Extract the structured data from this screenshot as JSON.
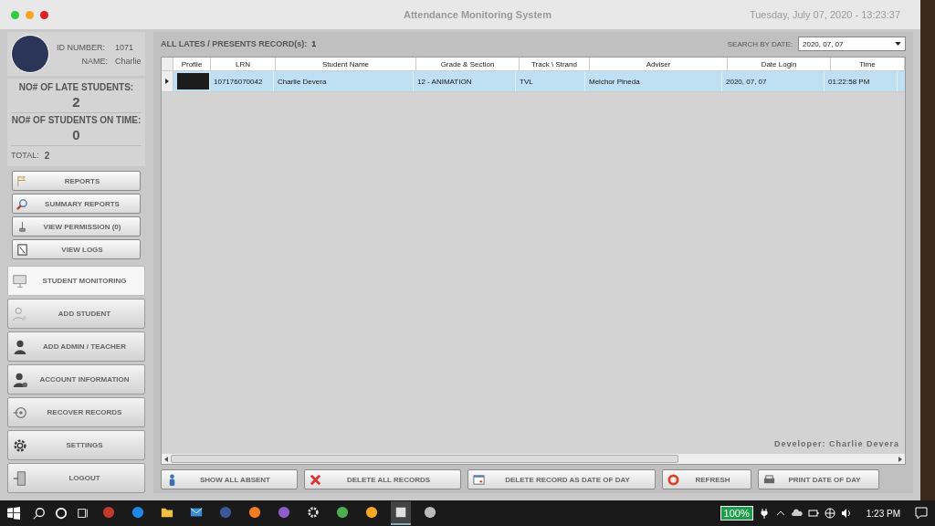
{
  "window": {
    "title": "Attendance Monitoring System",
    "datetime": "Tuesday, July  07, 2020 - 13:23:37"
  },
  "user": {
    "id_label": "ID NUMBER:",
    "id": "1071",
    "name_label": "NAME:",
    "name": "Charlie"
  },
  "stats": {
    "late_label": "NO# OF LATE STUDENTS:",
    "late": "2",
    "ontime_label": "NO# OF STUDENTS ON TIME:",
    "ontime": "0",
    "total_label": "TOTAL:",
    "total": "2"
  },
  "report_buttons": [
    {
      "label": "REPORTS",
      "kind": "flag"
    },
    {
      "label": "SUMMARY REPORTS",
      "kind": "search"
    },
    {
      "label": "VIEW PERMISSION (0)",
      "kind": "pin"
    },
    {
      "label": "VIEW LOGS",
      "kind": "log"
    }
  ],
  "nav": [
    {
      "label": "STUDENT MONITORING",
      "kind": "monitor",
      "selected": true
    },
    {
      "label": "ADD STUDENT",
      "kind": "user-outline",
      "selected": false
    },
    {
      "label": "ADD ADMIN / TEACHER",
      "kind": "user",
      "selected": false
    },
    {
      "label": "ACCOUNT INFORMATION",
      "kind": "user-info",
      "selected": false
    },
    {
      "label": "RECOVER RECORDS",
      "kind": "recover",
      "selected": false
    },
    {
      "label": "SETTINGS",
      "kind": "gear",
      "selected": false
    },
    {
      "label": "LOGOUT",
      "kind": "door",
      "selected": false
    }
  ],
  "records": {
    "title": "ALL LATES / PRESENTS RECORD(s):",
    "count": "1",
    "search_label": "SEARCH BY DATE:",
    "search_value": "2020, 07, 07"
  },
  "table": {
    "columns": [
      "Profile",
      "LRN",
      "Student Name",
      "Grade & Section",
      "Track \\ Strand",
      "Adviser",
      "Date Login",
      "Time"
    ],
    "rows": [
      {
        "selected": true,
        "cells": [
          "",
          "107176070042",
          "Charlie Devera",
          "12 - ANIMATION",
          "TVL",
          "Melchor Pineda",
          "2020, 07, 07",
          "01:22:58 PM"
        ]
      }
    ]
  },
  "developer": "Developer: Charlie Devera",
  "actions": [
    {
      "label": "SHOW ALL ABSENT",
      "kind": "person"
    },
    {
      "label": "DELETE ALL RECORDS",
      "kind": "x"
    },
    {
      "label": "DELETE RECORD AS DATE OF DAY",
      "kind": "calendar"
    },
    {
      "label": "REFRESH",
      "kind": "refresh"
    },
    {
      "label": "PRINT DATE OF DAY",
      "kind": "printer"
    }
  ],
  "taskbar": {
    "apps": [
      {
        "kind": "vivaldi",
        "selected": false
      },
      {
        "kind": "edge",
        "selected": false
      },
      {
        "kind": "folder",
        "selected": false
      },
      {
        "kind": "mail",
        "selected": false
      },
      {
        "kind": "facebook",
        "selected": false
      },
      {
        "kind": "xampp",
        "selected": false
      },
      {
        "kind": "visualstudio",
        "selected": false
      },
      {
        "kind": "gear",
        "selected": false
      },
      {
        "kind": "chrome",
        "selected": false
      },
      {
        "kind": "target",
        "selected": false
      },
      {
        "kind": "window",
        "selected": true
      },
      {
        "kind": "paint",
        "selected": false
      }
    ],
    "battery": "100%",
    "clock": "1:23 PM"
  }
}
